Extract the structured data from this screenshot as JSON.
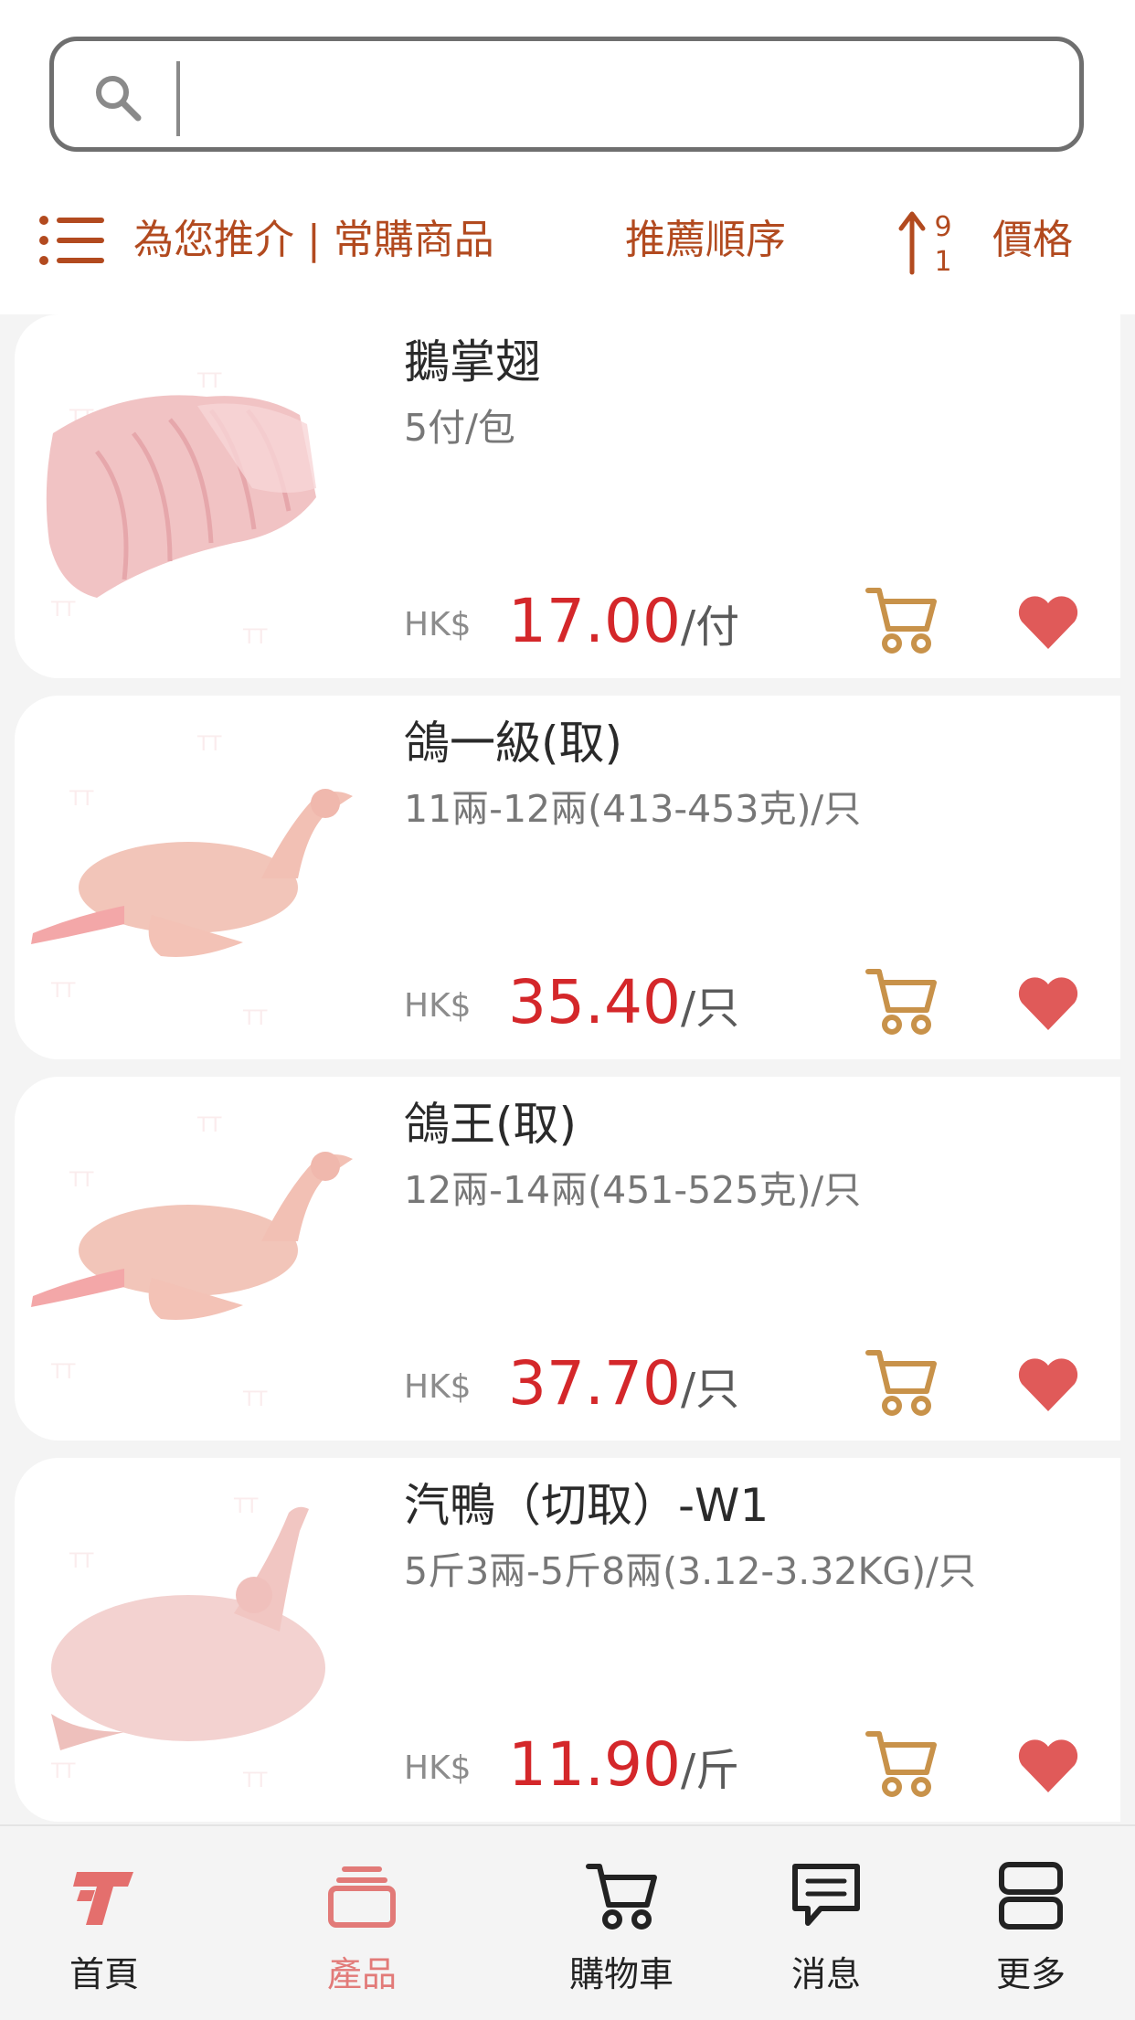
{
  "search": {
    "placeholder": ""
  },
  "filter": {
    "recommend_label": "為您推介 | 常購商品",
    "order_label": "推薦順序",
    "price_label": "價格"
  },
  "products": [
    {
      "name": "鵝掌翅",
      "spec": "5付/包",
      "currency": "HK$",
      "price": "17.00",
      "unit": "/付",
      "image": "goose-webs-wings"
    },
    {
      "name": "鴿一級(取)",
      "spec": "11兩-12兩(413-453克)/只",
      "currency": "HK$",
      "price": "35.40",
      "unit": "/只",
      "image": "pigeon"
    },
    {
      "name": "鴿王(取)",
      "spec": "12兩-14兩(451-525克)/只",
      "currency": "HK$",
      "price": "37.70",
      "unit": "/只",
      "image": "pigeon"
    },
    {
      "name": "汽鴨（切取）-W1",
      "spec": "5斤3兩-5斤8兩(3.12-3.32KG)/只",
      "currency": "HK$",
      "price": "11.90",
      "unit": "/斤",
      "image": "duck"
    }
  ],
  "tabs": [
    {
      "label": "首頁",
      "icon": "home-logo-icon",
      "active": false
    },
    {
      "label": "產品",
      "icon": "products-icon",
      "active": true
    },
    {
      "label": "購物車",
      "icon": "cart-icon",
      "active": false
    },
    {
      "label": "消息",
      "icon": "message-icon",
      "active": false
    },
    {
      "label": "更多",
      "icon": "more-icon",
      "active": false
    }
  ],
  "colors": {
    "accent": "#b24a1f",
    "price": "#d4272a",
    "cart": "#c8924a",
    "heart": "#e05a59",
    "active_tab": "#e27a78"
  }
}
